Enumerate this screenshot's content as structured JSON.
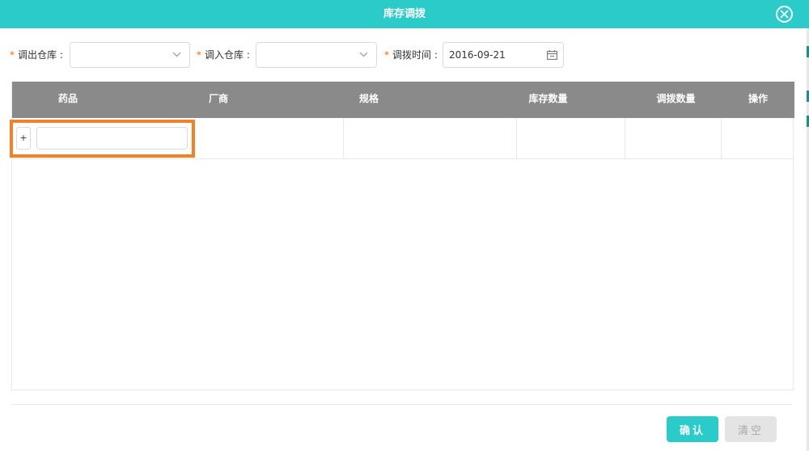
{
  "dialog": {
    "title": "库存调拨"
  },
  "form": {
    "required_mark": "*",
    "out_warehouse": {
      "label": "调出仓库 :",
      "value": ""
    },
    "in_warehouse": {
      "label": "调入仓库 :",
      "value": ""
    },
    "transfer_time": {
      "label": "调拨时间 :",
      "value": "2016-09-21"
    }
  },
  "table": {
    "columns": [
      "药品",
      "厂商",
      "规格",
      "库存数量",
      "调拨数量",
      "操作"
    ],
    "row": {
      "add_label": "+",
      "drug_value": ""
    }
  },
  "footer": {
    "confirm_label": "确认",
    "clear_label": "清空"
  },
  "colors": {
    "header": "#2bcbca",
    "table_header": "#8a8a8a",
    "highlight": "#f48125",
    "required": "#f56a00"
  },
  "icons": {
    "close": "close-circle-icon",
    "dropdown": "chevron-down-icon",
    "calendar": "calendar-icon"
  }
}
